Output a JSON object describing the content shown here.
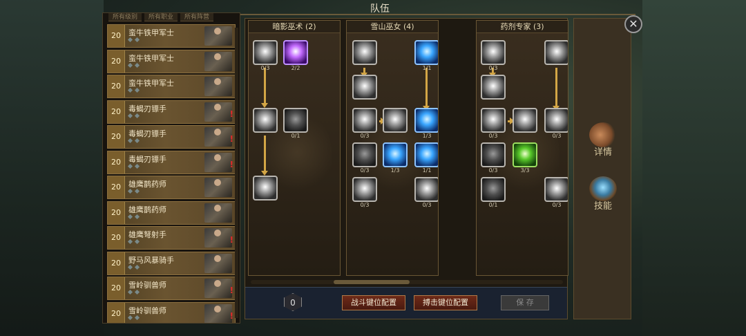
{
  "window": {
    "title": "队伍"
  },
  "roster": {
    "tabs": [
      "所有级别",
      "所有职业",
      "所有阵营"
    ],
    "units": [
      {
        "level": "20",
        "name": "蛮牛铁甲军士",
        "alert": false
      },
      {
        "level": "20",
        "name": "蛮牛铁甲军士",
        "alert": false
      },
      {
        "level": "20",
        "name": "蛮牛铁甲军士",
        "alert": false
      },
      {
        "level": "20",
        "name": "毒蝎刃镖手",
        "alert": true
      },
      {
        "level": "20",
        "name": "毒蝎刃镖手",
        "alert": true
      },
      {
        "level": "20",
        "name": "毒蝎刃镖手",
        "alert": true
      },
      {
        "level": "20",
        "name": "雄鹰鹊药师",
        "alert": false
      },
      {
        "level": "20",
        "name": "雄鹰鹊药师",
        "alert": false
      },
      {
        "level": "20",
        "name": "雄鹰弩射手",
        "alert": true
      },
      {
        "level": "20",
        "name": "野马风暴骑手",
        "alert": false
      },
      {
        "level": "20",
        "name": "雪岭驯兽师",
        "alert": true
      },
      {
        "level": "20",
        "name": "雪岭驯兽师",
        "alert": true
      }
    ]
  },
  "skill_trees": [
    {
      "title": "暗影巫术 (2)",
      "skills": [
        {
          "icon": "shadow-burst-icon",
          "count": "0/3",
          "style": "plain"
        },
        {
          "icon": "void-sigil-icon",
          "count": "2/2",
          "style": "purple"
        },
        {
          "icon": "shadow-hand-icon",
          "count": "",
          "style": "plain"
        },
        {
          "icon": "spiral-icon",
          "count": "0/1",
          "style": "dark"
        },
        {
          "icon": "shadow-dash-icon",
          "count": "",
          "style": "plain"
        }
      ]
    },
    {
      "title": "雪山巫女 (4)",
      "skills": [
        {
          "icon": "frost-helm-icon",
          "count": "",
          "style": "plain"
        },
        {
          "icon": "ice-comet-icon",
          "count": "1/1",
          "style": "blue"
        },
        {
          "icon": "wind-ring-icon",
          "count": "",
          "style": "plain"
        },
        {
          "icon": "frost-eye-icon",
          "count": "0/3",
          "style": "plain"
        },
        {
          "icon": "snow-burst-icon",
          "count": "",
          "style": "plain"
        },
        {
          "icon": "ice-nova-icon",
          "count": "1/3",
          "style": "blue"
        },
        {
          "icon": "frost-shield-icon",
          "count": "0/3",
          "style": "dark"
        },
        {
          "icon": "ice-orb-icon",
          "count": "1/3",
          "style": "blue"
        },
        {
          "icon": "frost-bolt-icon",
          "count": "1/1",
          "style": "blue"
        },
        {
          "icon": "ice-spikes-icon",
          "count": "0/3",
          "style": "plain"
        },
        {
          "icon": "ice-shards-icon",
          "count": "0/3",
          "style": "plain"
        }
      ]
    },
    {
      "title": "药剂专家 (3)",
      "skills": [
        {
          "icon": "potion-flare-icon",
          "count": "0/3",
          "style": "plain"
        },
        {
          "icon": "crown-aura-icon",
          "count": "",
          "style": "plain"
        },
        {
          "icon": "potion-splash-icon",
          "count": "",
          "style": "plain"
        },
        {
          "icon": "elixir-burst-icon",
          "count": "0/3",
          "style": "plain"
        },
        {
          "icon": "elixir-star-icon",
          "count": "",
          "style": "plain"
        },
        {
          "icon": "elixir-flash-icon",
          "count": "0/3",
          "style": "plain"
        },
        {
          "icon": "leaf-icon",
          "count": "0/3",
          "style": "dark"
        },
        {
          "icon": "poison-blade-icon",
          "count": "3/3",
          "style": "green"
        },
        {
          "icon": "golem-icon",
          "count": "0/1",
          "style": "dark"
        },
        {
          "icon": "herb-burst-icon",
          "count": "0/3",
          "style": "plain"
        }
      ]
    }
  ],
  "footer": {
    "points": "0",
    "combat_keys_label": "战斗键位配置",
    "siege_keys_label": "搏击键位配置",
    "save_label": "保 存"
  },
  "side_tabs": [
    {
      "label": "详情",
      "icon": "muscle-arm-icon"
    },
    {
      "label": "技能",
      "icon": "skill-book-icon"
    }
  ]
}
